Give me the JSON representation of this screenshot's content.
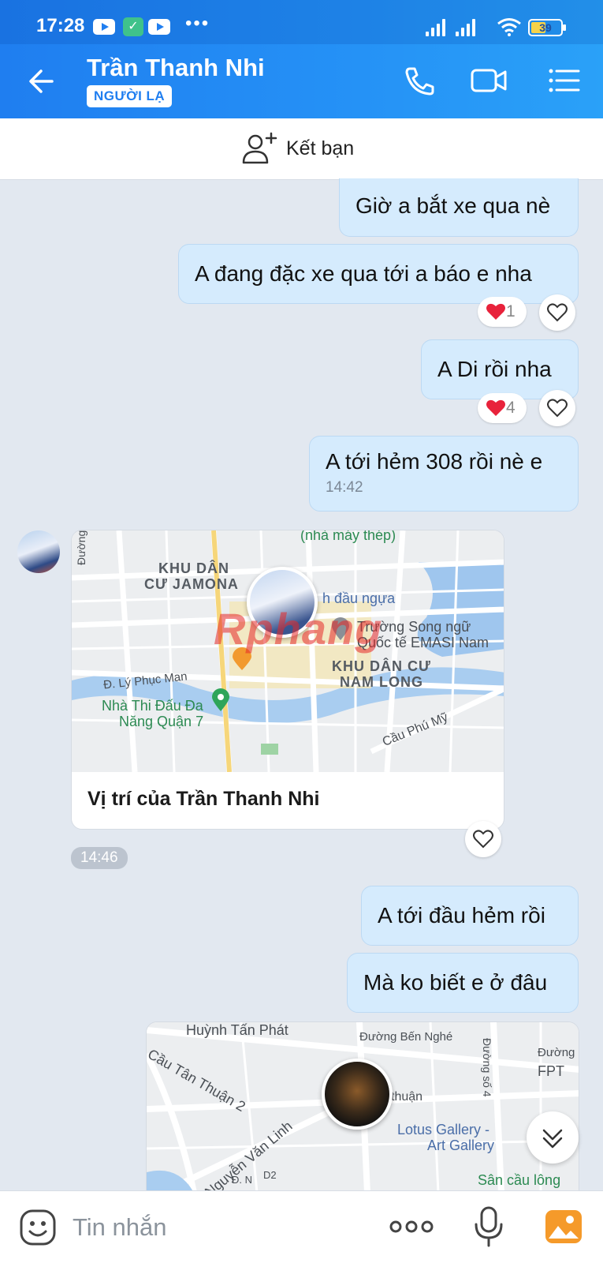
{
  "status_bar": {
    "time": "17:28",
    "battery": "39",
    "icons": [
      "youtube-icon",
      "zalo-icon",
      "youtube-icon",
      "more-dots-icon",
      "signal-icon",
      "signal-icon",
      "wifi-icon",
      "battery-icon"
    ]
  },
  "header": {
    "contact_name": "Trần Thanh Nhi",
    "badge": "NGƯỜI LẠ",
    "icons": [
      "back-arrow-icon",
      "phone-icon",
      "video-call-icon",
      "menu-list-icon"
    ]
  },
  "add_friend": {
    "label": "Kết bạn",
    "icon": "add-user-icon"
  },
  "messages": [
    {
      "text": "Giờ a bắt xe qua nè"
    },
    {
      "text": "A đang đặc xe qua tới a báo e nha",
      "reaction_count": "1"
    },
    {
      "text": "A Di rồi nha",
      "reaction_count": "4"
    },
    {
      "text": "A tới hẻm 308 rồi nè e",
      "time": "14:42"
    },
    {
      "text": "A tới đầu hẻm rồi"
    },
    {
      "text": "Mà ko biết e ở đâu"
    }
  ],
  "location_card": {
    "caption": "Vị trí của Trần Thanh Nhi",
    "time": "14:46",
    "map_labels": [
      "(nhà máy thép)",
      "Đường",
      "KHU DÂN",
      "CƯ JAMONA",
      "h đầu ngựa",
      "Trường Song ngữ",
      "Quốc tế EMASI Nam",
      "KHU DÂN CƯ",
      "NAM LONG",
      "Đ. Lý Phục Man",
      "Nhà Thi Đấu Đa",
      "Năng Quận 7",
      "Cầu Phú Mỹ"
    ],
    "watermark": "Rphang"
  },
  "location_card_2": {
    "map_labels": [
      "Huỳnh Tấn Phát",
      "Đường Bến Nghé",
      "Đường số 4",
      "Đường",
      "FPT",
      "Cầu Tân Thuận 2",
      "thuận",
      "Lotus Gallery -",
      "Art Gallery",
      "Nguyễn Văn Linh",
      "Đ. N",
      "D2",
      "Sân cầu lông"
    ]
  },
  "input_bar": {
    "placeholder": "Tin nhắn",
    "icons": [
      "emoji-icon",
      "more-dots-icon",
      "microphone-icon",
      "photo-icon"
    ]
  },
  "colors": {
    "header": "#1f7ef0",
    "my_bubble": "#d5ebfd",
    "background": "#e2e8f0",
    "heart": "#e8223b"
  }
}
